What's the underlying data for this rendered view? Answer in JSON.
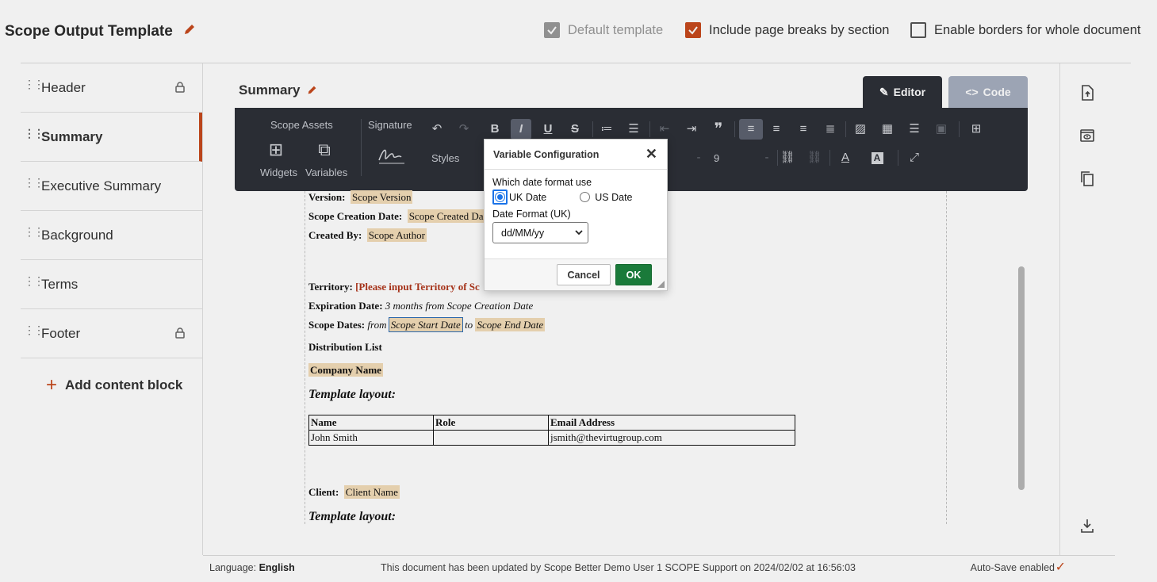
{
  "header": {
    "title": "Scope Output Template",
    "options": [
      {
        "label": "Default template",
        "checked": true,
        "disabled": true
      },
      {
        "label": "Include page breaks by section",
        "checked": true,
        "disabled": false
      },
      {
        "label": "Enable borders for whole document",
        "checked": false,
        "disabled": false
      }
    ]
  },
  "sidebar": {
    "items": [
      {
        "label": "Header",
        "locked": true
      },
      {
        "label": "Summary",
        "active": true
      },
      {
        "label": "Executive Summary"
      },
      {
        "label": "Background"
      },
      {
        "label": "Terms"
      },
      {
        "label": "Footer",
        "locked": true
      }
    ],
    "add_label": "Add content block"
  },
  "main": {
    "section_title": "Summary",
    "tabs": [
      {
        "label": "Editor",
        "active": true
      },
      {
        "label": "Code"
      }
    ]
  },
  "toolbar": {
    "scope_assets": "Scope Assets",
    "signature": "Signature",
    "widgets": "Widgets",
    "variables": "Variables",
    "styles": "Styles",
    "font_size": "9",
    "bold": "B",
    "italic": "I",
    "underline": "U",
    "strike": "S"
  },
  "document": {
    "version_label": "Version:",
    "version_var": "Scope Version",
    "creation_label": "Scope Creation Date:",
    "creation_var": "Scope Created Da",
    "created_by_label": "Created By:",
    "created_by_var": "Scope Author",
    "territory_label": "Territory:",
    "territory_val": "[Please input Territory of Sc",
    "expiration_label": "Expiration Date:",
    "expiration_val": "3 months from Scope Creation Date",
    "dates_label": "Scope Dates:",
    "dates_from": "from",
    "dates_start": "Scope Start Date",
    "dates_to": "to",
    "dates_end": "Scope End Date",
    "distribution": "Distribution List",
    "company": "Company Name",
    "template_layout": "Template layout:",
    "table": {
      "headers": [
        "Name",
        "Role",
        "Email Address"
      ],
      "rows": [
        [
          "John Smith",
          "",
          "jsmith@thevirtugroup.com"
        ]
      ]
    },
    "client_label": "Client:",
    "client_var": "Client Name",
    "template_layout_2": "Template layout:"
  },
  "dialog": {
    "title": "Variable Configuration",
    "question": "Which date format use",
    "option_uk": "UK Date",
    "option_us": "US Date",
    "selected": "UK Date",
    "format_label": "Date Format (UK)",
    "format_value": "dd/MM/yy",
    "cancel": "Cancel",
    "ok": "OK"
  },
  "footer": {
    "language_label": "Language:",
    "language_value": "English",
    "updated": "This document has been updated by Scope Better Demo User 1 SCOPE Support on 2024/02/02 at 16:56:03",
    "autosave": "Auto-Save enabled"
  },
  "colors": {
    "accent": "#c74a1d",
    "toolbar_bg": "#2d3038",
    "variable_highlight": "#f3dcb8",
    "ok_button": "#1a7a3a"
  }
}
